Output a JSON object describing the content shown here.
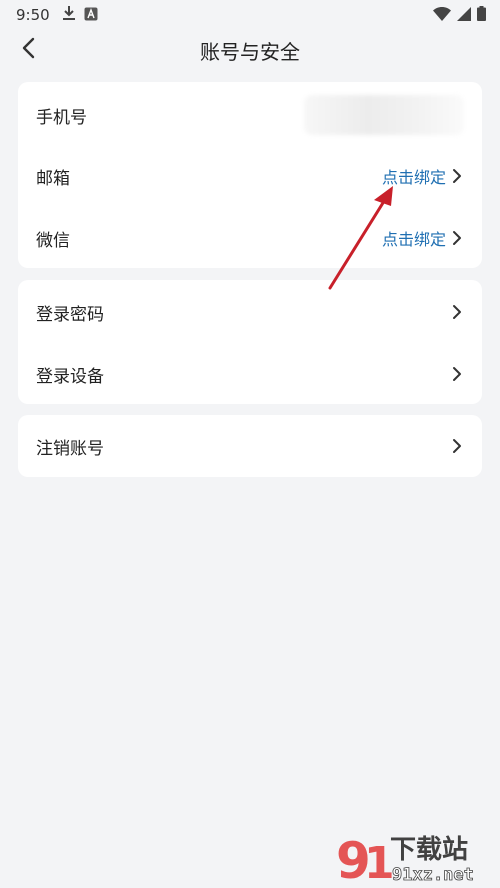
{
  "status_bar": {
    "time": "9:50",
    "icons": [
      "download-icon",
      "a-icon",
      "wifi-icon",
      "signal-icon",
      "battery-icon"
    ]
  },
  "header": {
    "title": "账号与安全",
    "back_icon": "chevron-left-icon"
  },
  "card_account": {
    "items": [
      {
        "label": "手机号",
        "value": ""
      },
      {
        "label": "邮箱",
        "action": "点击绑定"
      },
      {
        "label": "微信",
        "action": "点击绑定"
      }
    ]
  },
  "card_security": {
    "items": [
      {
        "label": "登录密码"
      },
      {
        "label": "登录设备"
      }
    ]
  },
  "card_cancel": {
    "items": [
      {
        "label": "注销账号"
      }
    ]
  },
  "colors": {
    "accent": "#1f6fb2",
    "background": "#f3f4f6",
    "card": "#ffffff",
    "annotation_arrow": "#c8202a"
  },
  "watermark": {
    "brand": "下载站",
    "site": "91xz.net",
    "logo": "91"
  }
}
